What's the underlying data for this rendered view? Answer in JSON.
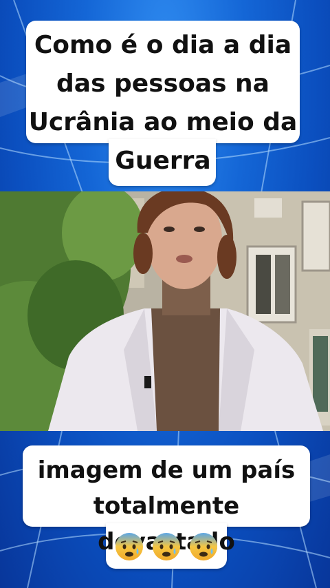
{
  "caption_top": {
    "lines": [
      "Como é o dia a dia",
      "das pessoas na",
      "Ucrânia ao meio da",
      "Guerra"
    ]
  },
  "caption_bottom": {
    "lines": [
      "imagem de um país",
      "totalmente devastado"
    ],
    "emoji": [
      "anxious-face",
      "anxious-face",
      "anxious-face"
    ]
  },
  "video": {
    "description_icon": "reporter-video-frame"
  },
  "colors": {
    "background_blue": "#0b4fbf",
    "caption_bg": "#ffffff",
    "caption_text": "#111111"
  }
}
